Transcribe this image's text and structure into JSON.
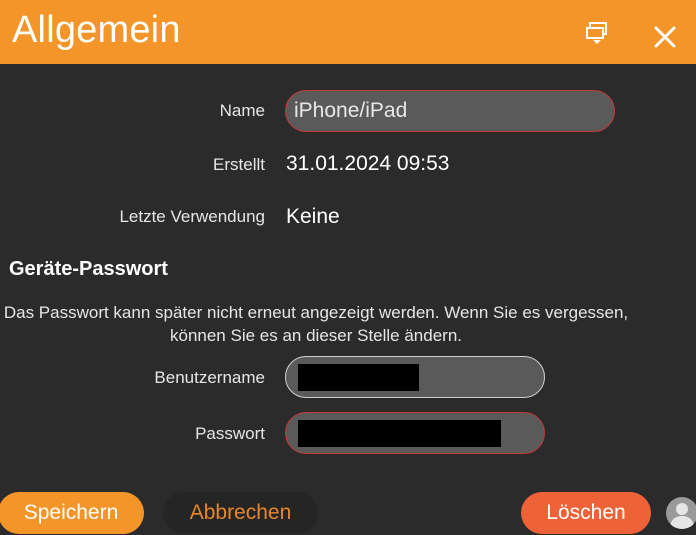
{
  "dialog": {
    "title": "Allgemein",
    "popout_icon": "popout-window-icon",
    "close_icon": "close-icon"
  },
  "general": {
    "name_label": "Name",
    "name_value": "iPhone/iPad",
    "created_label": "Erstellt",
    "created_value": "31.01.2024 09:53",
    "last_used_label": "Letzte Verwendung",
    "last_used_value": "Keine"
  },
  "device_password": {
    "heading": "Geräte-Passwort",
    "info": "Das Passwort kann später nicht erneut angezeigt werden. Wenn Sie es vergessen, können Sie es an dieser Stelle ändern.",
    "username_label": "Benutzername",
    "password_label": "Passwort"
  },
  "buttons": {
    "save": "Speichern",
    "cancel": "Abbrechen",
    "delete": "Löschen"
  },
  "colors": {
    "accent": "#f39528",
    "danger": "#ee6238",
    "background": "#2b2b2b",
    "invalid_border": "#c0393b"
  }
}
